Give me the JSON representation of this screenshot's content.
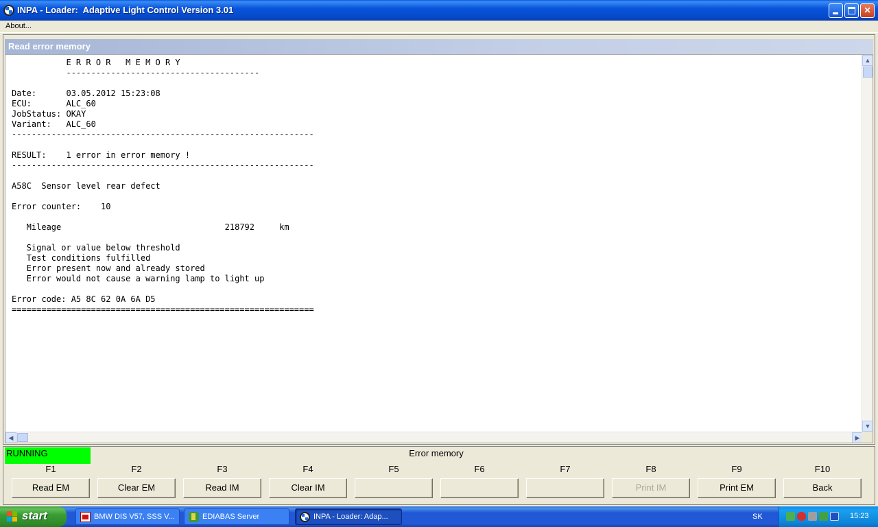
{
  "window": {
    "title": "INPA - Loader:  Adaptive Light Control Version 3.01",
    "app_icon": "bmw-logo-icon"
  },
  "menu": {
    "items": [
      "About..."
    ]
  },
  "panel": {
    "header": "Read error memory"
  },
  "report_lines": [
    "           E R R O R   M E M O R Y",
    "           ---------------------------------------",
    "",
    "Date:      03.05.2012 15:23:08",
    "ECU:       ALC_60",
    "JobStatus: OKAY",
    "Variant:   ALC_60",
    "-------------------------------------------------------------",
    "",
    "RESULT:    1 error in error memory !",
    "-------------------------------------------------------------",
    "",
    "A58C  Sensor level rear defect",
    "",
    "Error counter:    10",
    "",
    "   Mileage                                 218792     km",
    "",
    "   Signal or value below threshold",
    "   Test conditions fulfilled",
    "   Error present now and already stored",
    "   Error would not cause a warning lamp to light up",
    "",
    "Error code: A5 8C 62 0A 6A D5",
    "============================================================="
  ],
  "status": {
    "state": "RUNNING",
    "state_color": "#00ff00",
    "caption": "Error memory"
  },
  "function_keys": [
    {
      "key": "F1",
      "label": "Read EM",
      "enabled": true
    },
    {
      "key": "F2",
      "label": "Clear EM",
      "enabled": true
    },
    {
      "key": "F3",
      "label": "Read IM",
      "enabled": true
    },
    {
      "key": "F4",
      "label": "Clear IM",
      "enabled": true
    },
    {
      "key": "F5",
      "label": "",
      "enabled": true
    },
    {
      "key": "F6",
      "label": "",
      "enabled": true
    },
    {
      "key": "F7",
      "label": "",
      "enabled": true
    },
    {
      "key": "F8",
      "label": "Print IM",
      "enabled": false
    },
    {
      "key": "F9",
      "label": "Print EM",
      "enabled": true
    },
    {
      "key": "F10",
      "label": "Back",
      "enabled": true
    }
  ],
  "taskbar": {
    "start_label": "start",
    "tasks": [
      {
        "label": "BMW DIS V57, SSS V...",
        "icon": "pdf-icon",
        "active": false
      },
      {
        "label": "EDIABAS Server",
        "icon": "ediabas-icon",
        "active": false
      },
      {
        "label": "INPA - Loader:  Adap...",
        "icon": "bmw-logo-icon",
        "active": true
      }
    ],
    "language": "SK",
    "clock": "15:23"
  }
}
